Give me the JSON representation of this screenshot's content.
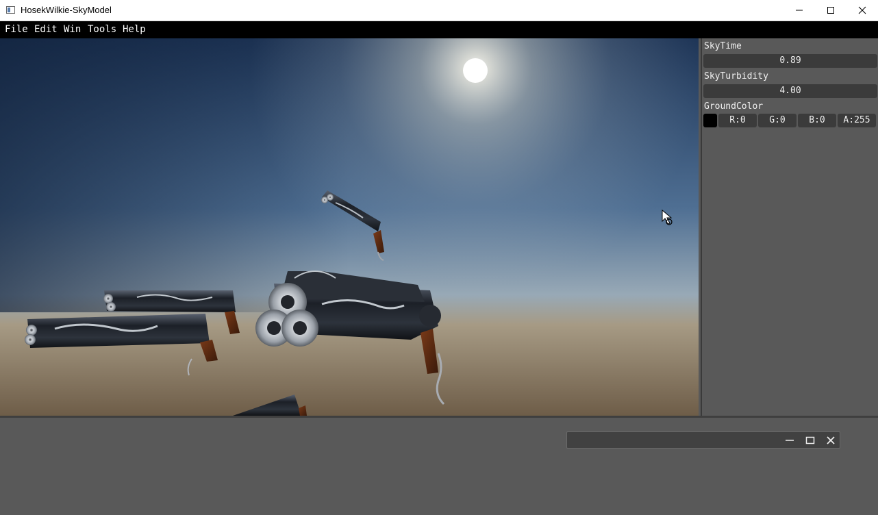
{
  "window": {
    "title": "HosekWilkie-SkyModel",
    "minimize_label": "minimize",
    "maximize_label": "maximize",
    "close_label": "close"
  },
  "menu": {
    "items": [
      "File",
      "Edit",
      "Win",
      "Tools",
      "Help"
    ]
  },
  "inspector": {
    "sky_time_label": "SkyTime",
    "sky_time_value": "0.89",
    "sky_turbidity_label": "SkyTurbidity",
    "sky_turbidity_value": "4.00",
    "ground_color_label": "GroundColor",
    "ground_color_swatch": "#000000",
    "r": "R:0",
    "g": "G:0",
    "b": "B:0",
    "a": "A:255"
  },
  "scene": {
    "sky_top_color": "#1d3456",
    "sky_mid_color": "#8aa2b8",
    "horizon_color": "#9a8a72",
    "ground_color": "#6e5d48",
    "sun_color": "#ffffff",
    "objects": [
      "revolver",
      "revolver",
      "revolver",
      "revolver",
      "revolver"
    ]
  },
  "floating_window": {
    "title": ""
  }
}
